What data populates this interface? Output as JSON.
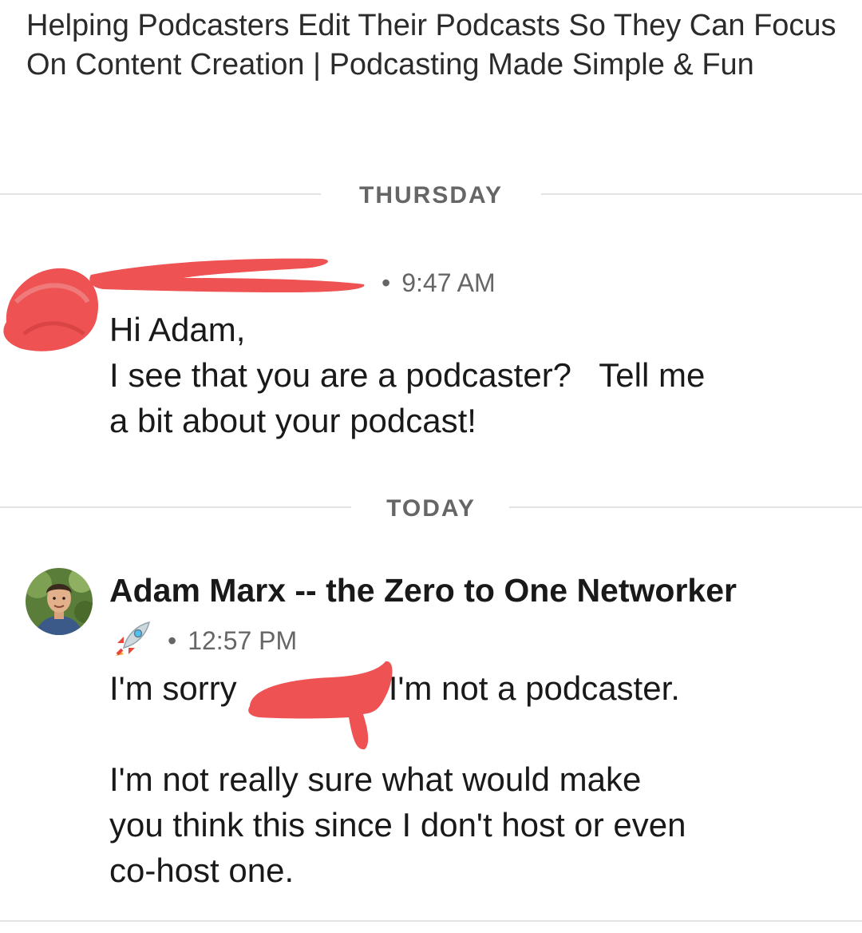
{
  "profile": {
    "headline": "Helping Podcasters Edit Their Podcasts So They Can Focus On Content Creation | Podcasting Made Simple & Fun"
  },
  "dividers": {
    "first": "THURSDAY",
    "second": "TODAY"
  },
  "messages": [
    {
      "sender": "",
      "time": "9:47 AM",
      "lines": [
        "Hi Adam,",
        "I see that you are a podcaster?   Tell me",
        "a bit about your podcast!"
      ]
    },
    {
      "sender": "Adam Marx -- the Zero to One Networker",
      "sender_emoji": "rocket-icon",
      "time": "12:57 PM",
      "line1_a": "I'm sorry",
      "line1_b": "I'm not a podcaster.",
      "lines": [
        "I'm not really sure what would make",
        "you think this since I don't host or even",
        "co-host one."
      ]
    }
  ],
  "colors": {
    "redaction": "#ee5253",
    "divider": "#e3e3e3",
    "meta_text": "#666666"
  }
}
